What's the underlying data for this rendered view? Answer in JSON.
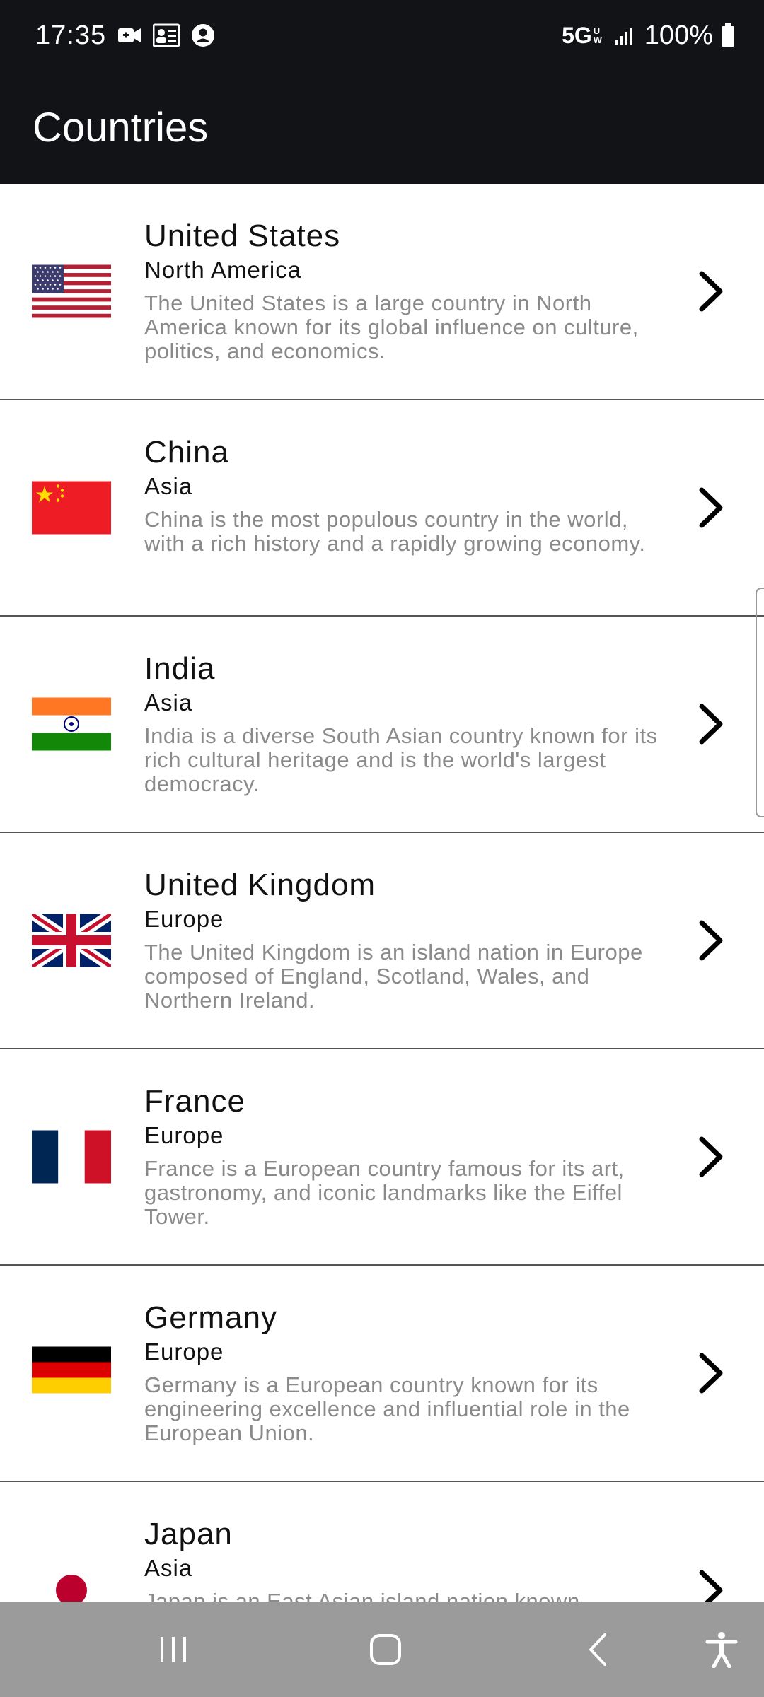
{
  "status_bar": {
    "time": "17:35",
    "network": "5G",
    "network_sub": "UW",
    "battery": "100%",
    "icons": [
      "video-call-icon",
      "contact-card-icon",
      "account-circle-icon",
      "signal-icon",
      "battery-icon"
    ]
  },
  "app_bar": {
    "title": "Countries"
  },
  "countries": [
    {
      "name": "United States",
      "continent": "North America",
      "description": "The United States is a large country in North America known for its global influence on culture, politics, and economics.",
      "flag": "us-flag-icon"
    },
    {
      "name": "China",
      "continent": "Asia",
      "description": "China is the most populous country in the world, with a rich history and a rapidly growing economy.",
      "flag": "china-flag-icon"
    },
    {
      "name": "India",
      "continent": "Asia",
      "description": "India is a diverse South Asian country known for its rich cultural heritage and is the world's largest democracy.",
      "flag": "india-flag-icon"
    },
    {
      "name": "United Kingdom",
      "continent": "Europe",
      "description": "The United Kingdom is an island nation in Europe composed of England, Scotland, Wales, and Northern Ireland.",
      "flag": "uk-flag-icon"
    },
    {
      "name": "France",
      "continent": "Europe",
      "description": "France is a European country famous for its art, gastronomy, and iconic landmarks like the Eiffel Tower.",
      "flag": "france-flag-icon"
    },
    {
      "name": "Germany",
      "continent": "Europe",
      "description": "Germany is a European country known for its engineering excellence and influential role in the European Union.",
      "flag": "germany-flag-icon"
    },
    {
      "name": "Japan",
      "continent": "Asia",
      "description": "Japan is an East Asian island nation known",
      "flag": "japan-flag-icon"
    }
  ],
  "nav_bar": {
    "icons": [
      "recent-apps-icon",
      "home-icon",
      "back-icon",
      "accessibility-icon"
    ]
  },
  "colors": {
    "app_bar_bg": "#121316",
    "nav_bar_bg": "#9b9b9b",
    "description_text": "#8a8a8a",
    "divider": "#555555"
  }
}
